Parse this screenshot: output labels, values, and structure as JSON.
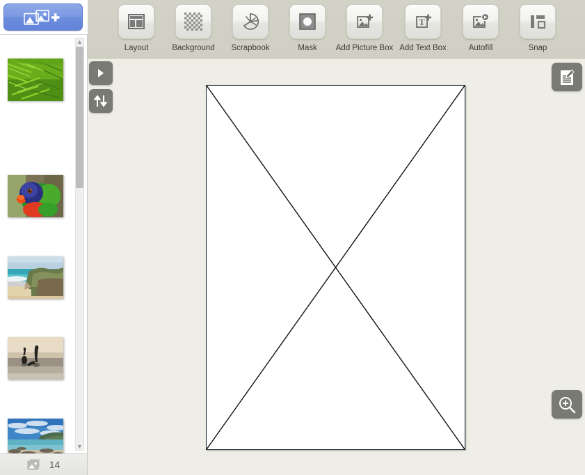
{
  "app": {
    "accent_blue": "#6c8cdd",
    "toolbar_bg": "#d0d0c4",
    "canvas_bg": "#eeeee6",
    "page_bg": "#ffffff"
  },
  "add_photos": {
    "name": "add-photos-button",
    "icon": "add-photos-icon",
    "label": ""
  },
  "toolbar": {
    "items": [
      {
        "label": "Layout",
        "icon": "layout-icon"
      },
      {
        "label": "Background",
        "icon": "background-checker-icon"
      },
      {
        "label": "Scrapbook",
        "icon": "scrapbook-icon"
      },
      {
        "label": "Mask",
        "icon": "mask-icon"
      },
      {
        "label": "Add Picture Box",
        "icon": "add-picture-box-icon"
      },
      {
        "label": "Add Text Box",
        "icon": "add-text-box-icon"
      },
      {
        "label": "Autofill",
        "icon": "autofill-icon"
      },
      {
        "label": "Snap",
        "icon": "snap-icon"
      }
    ]
  },
  "sidebar": {
    "thumbnails": [
      {
        "name": "thumbnail-ferns",
        "alt": "green fern leaves"
      },
      {
        "name": "thumbnail-parrot",
        "alt": "rainbow lorikeet parrot"
      },
      {
        "name": "thumbnail-cliffs",
        "alt": "coastal cliffs and beach"
      },
      {
        "name": "thumbnail-beach-figures",
        "alt": "two figures on wet sand at sunset"
      },
      {
        "name": "thumbnail-bay",
        "alt": "blue bay with rocks"
      }
    ],
    "scrollbar": {
      "up_arrow": "▲",
      "down_arrow": "▼"
    },
    "footer": {
      "icon": "photos-count-icon",
      "count": "14"
    }
  },
  "canvas": {
    "buttons": [
      {
        "name": "expand-panel-button",
        "icon": "triangle-right-icon"
      },
      {
        "name": "sort-button",
        "icon": "sort-up-down-icon"
      },
      {
        "name": "edit-page-button",
        "icon": "page-edit-icon"
      },
      {
        "name": "zoom-in-button",
        "icon": "magnifier-plus-icon"
      }
    ],
    "page": {
      "name": "page-canvas",
      "placeholder": "empty-picture-box-x"
    }
  }
}
